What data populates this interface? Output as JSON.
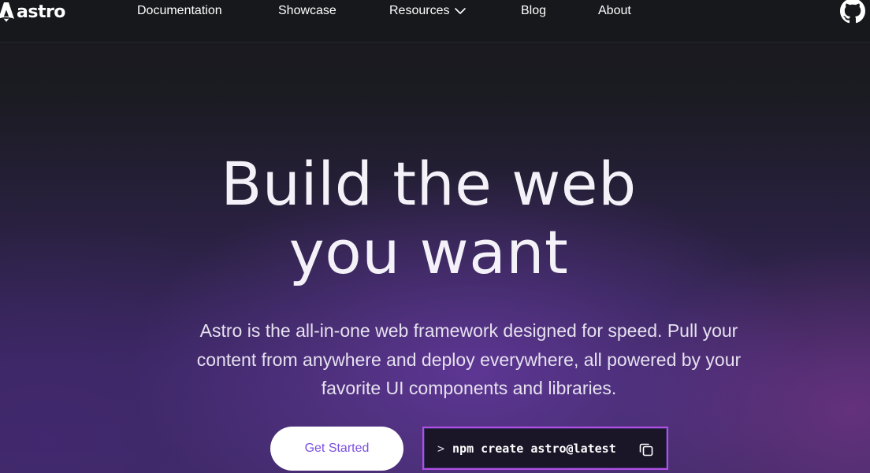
{
  "nav": {
    "logo_text": "astro",
    "links": [
      {
        "label": "Documentation"
      },
      {
        "label": "Showcase"
      },
      {
        "label": "Resources"
      },
      {
        "label": "Blog"
      },
      {
        "label": "About"
      }
    ],
    "github_icon": "github-icon"
  },
  "hero": {
    "title_line1": "Build the web",
    "title_line2": "you want",
    "description": "Astro is the all-in-one web framework designed for speed. Pull your content from anywhere and deploy everywhere, all powered by your favorite UI components and libraries.",
    "cta_label": "Get Started",
    "command_prompt": ">",
    "command_text": "npm create astro@latest",
    "copy_icon": "copy-icon"
  },
  "colors": {
    "nav_bg": "#17181c",
    "accent": "#7a4fe0",
    "command_border": "#b24fe3"
  }
}
